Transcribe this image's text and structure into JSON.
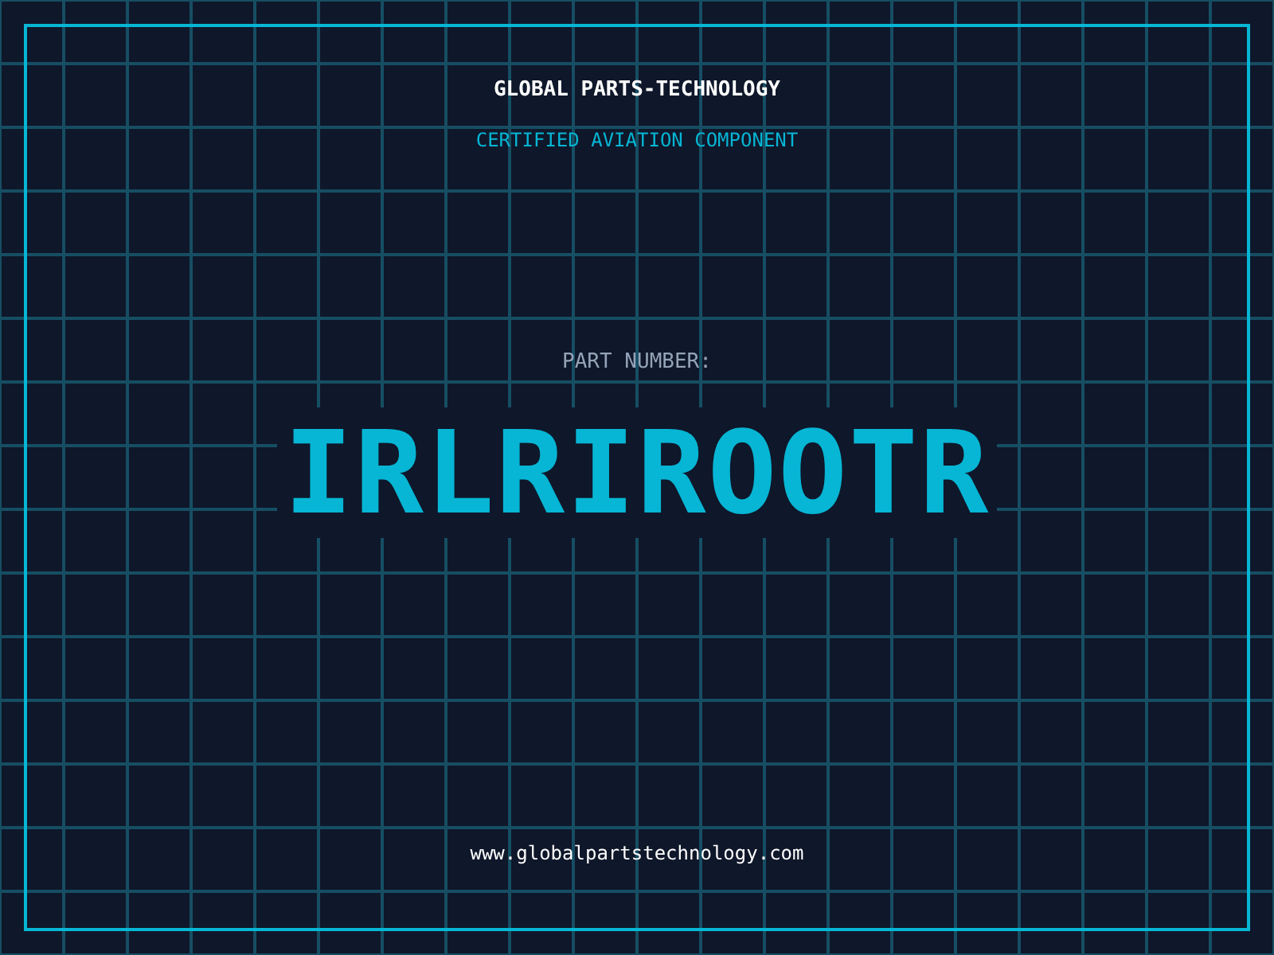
{
  "company": "GLOBAL PARTS-TECHNOLOGY",
  "subtitle": "CERTIFIED AVIATION COMPONENT",
  "part_label": "PART NUMBER:",
  "part_number": "IRLRIROOTR",
  "website": "www.globalpartstechnology.com"
}
